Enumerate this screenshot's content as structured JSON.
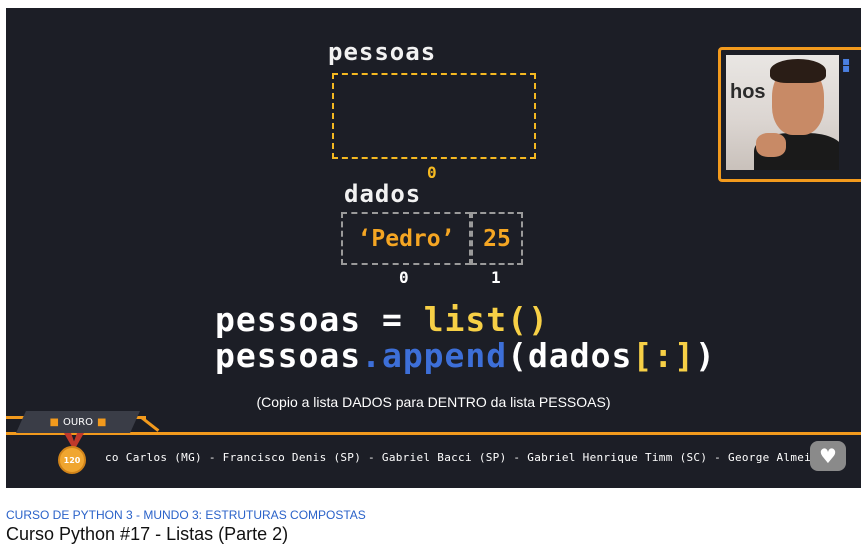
{
  "slide": {
    "pessoas_label": "pessoas",
    "pessoas_index": "0",
    "dados_label": "dados",
    "dados_cells": [
      "‘Pedro’",
      "25"
    ],
    "dados_indexes": [
      "0",
      "1"
    ],
    "code_line1": {
      "var": "pessoas",
      "op": " = ",
      "call": "list()"
    },
    "code_line2": {
      "var": "pessoas",
      "method": ".append",
      "arg_open": "(",
      "arg": "dados",
      "slice": "[:]",
      "arg_close": ")"
    },
    "caption": "(Copio a lista DADOS para DENTRO da lista PESSOAS)"
  },
  "webcam": {
    "logo": "hos",
    "blue_marks": "▪\n▪"
  },
  "ticker": {
    "badge_label": "OURO",
    "medal_number": "120",
    "names": "co Carlos (MG) - Francisco Denis (SP) - Gabriel Bacci (SP) - Gabriel Henrique Timm (SC) - George Almeida",
    "heart_icon": "♥"
  },
  "video_info": {
    "playlist": "CURSO DE PYTHON 3 - MUNDO 3: ESTRUTURAS COMPOSTAS",
    "title": "Curso Python #17 - Listas (Parte 2)"
  },
  "colors": {
    "background": "#1c1e26",
    "accent_orange": "#f29a1d",
    "code_yellow": "#f7d046",
    "code_blue": "#3d6fd8",
    "link_blue": "#2a62c9"
  }
}
